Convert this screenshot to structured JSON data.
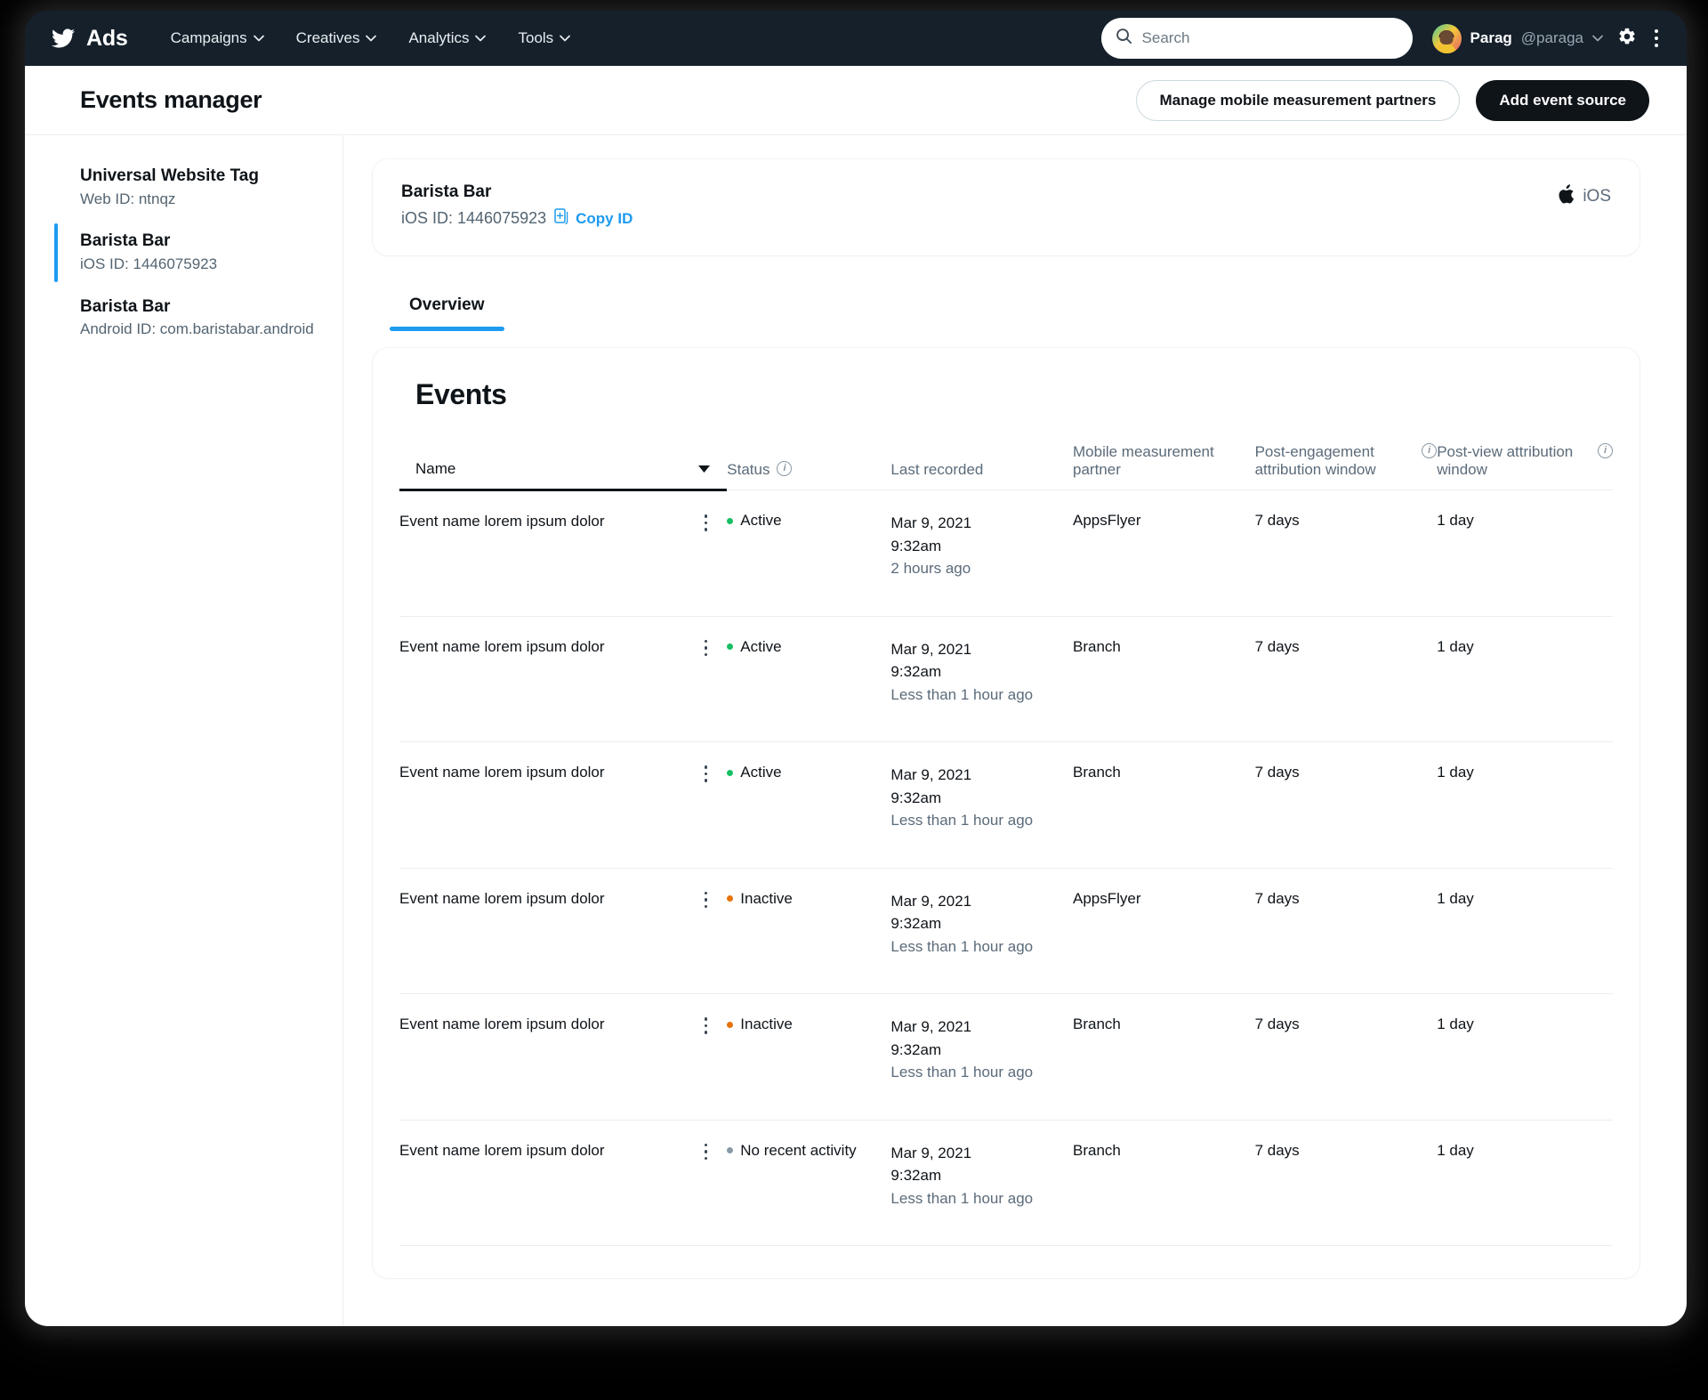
{
  "colors": {
    "brand_blue": "#1d9bf0",
    "dark": "#15202b",
    "active_green": "#17bf63",
    "inactive_orange": "#e8730a",
    "norecent_gray": "#8899a6"
  },
  "topnav": {
    "brand_label": "Ads",
    "items": [
      {
        "label": "Campaigns"
      },
      {
        "label": "Creatives"
      },
      {
        "label": "Analytics"
      },
      {
        "label": "Tools"
      }
    ],
    "search_placeholder": "Search",
    "search_value": "",
    "profile_name": "Parag",
    "profile_handle": "@paraga"
  },
  "header": {
    "title": "Events manager",
    "manage_button": "Manage mobile measurement partners",
    "add_button": "Add event source"
  },
  "sidebar": {
    "items": [
      {
        "title": "Universal Website Tag",
        "sub": "Web ID: ntnqz",
        "active": false
      },
      {
        "title": "Barista Bar",
        "sub": "iOS ID: 1446075923",
        "active": true
      },
      {
        "title": "Barista Bar",
        "sub": "Android ID: com.baristabar.android",
        "active": false
      }
    ]
  },
  "app_card": {
    "name": "Barista Bar",
    "id_label": "iOS ID: 1446075923",
    "copy_label": "Copy ID",
    "platform_label": "iOS"
  },
  "tabs": [
    {
      "label": "Overview",
      "active": true
    }
  ],
  "events": {
    "title": "Events",
    "columns": {
      "name": "Name",
      "status": "Status",
      "last_recorded": "Last recorded",
      "mmp": "Mobile measurement partner",
      "post_engagement": "Post-engagement attribution window",
      "post_view": "Post-view attribution window"
    },
    "rows": [
      {
        "name": "Event name lorem ipsum dolor",
        "status": "Active",
        "status_color": "#17bf63",
        "date": "Mar 9, 2021",
        "time": "9:32am",
        "relative": "2 hours ago",
        "mmp": "AppsFlyer",
        "post_engagement": "7 days",
        "post_view": "1 day"
      },
      {
        "name": "Event name lorem ipsum dolor",
        "status": "Active",
        "status_color": "#17bf63",
        "date": "Mar 9, 2021",
        "time": "9:32am",
        "relative": "Less than 1 hour ago",
        "mmp": "Branch",
        "post_engagement": "7 days",
        "post_view": "1 day"
      },
      {
        "name": "Event name lorem ipsum dolor",
        "status": "Active",
        "status_color": "#17bf63",
        "date": "Mar 9, 2021",
        "time": "9:32am",
        "relative": "Less than 1 hour ago",
        "mmp": "Branch",
        "post_engagement": "7 days",
        "post_view": "1 day"
      },
      {
        "name": "Event name lorem ipsum dolor",
        "status": "Inactive",
        "status_color": "#e8730a",
        "date": "Mar 9, 2021",
        "time": "9:32am",
        "relative": "Less than 1 hour ago",
        "mmp": "AppsFlyer",
        "post_engagement": "7 days",
        "post_view": "1 day"
      },
      {
        "name": "Event name lorem ipsum dolor",
        "status": "Inactive",
        "status_color": "#e8730a",
        "date": "Mar 9, 2021",
        "time": "9:32am",
        "relative": "Less than 1 hour ago",
        "mmp": "Branch",
        "post_engagement": "7 days",
        "post_view": "1 day"
      },
      {
        "name": "Event name lorem ipsum dolor",
        "status": "No recent activity",
        "status_color": "#8899a6",
        "date": "Mar 9, 2021",
        "time": "9:32am",
        "relative": "Less than 1 hour ago",
        "mmp": "Branch",
        "post_engagement": "7 days",
        "post_view": "1 day"
      }
    ]
  }
}
